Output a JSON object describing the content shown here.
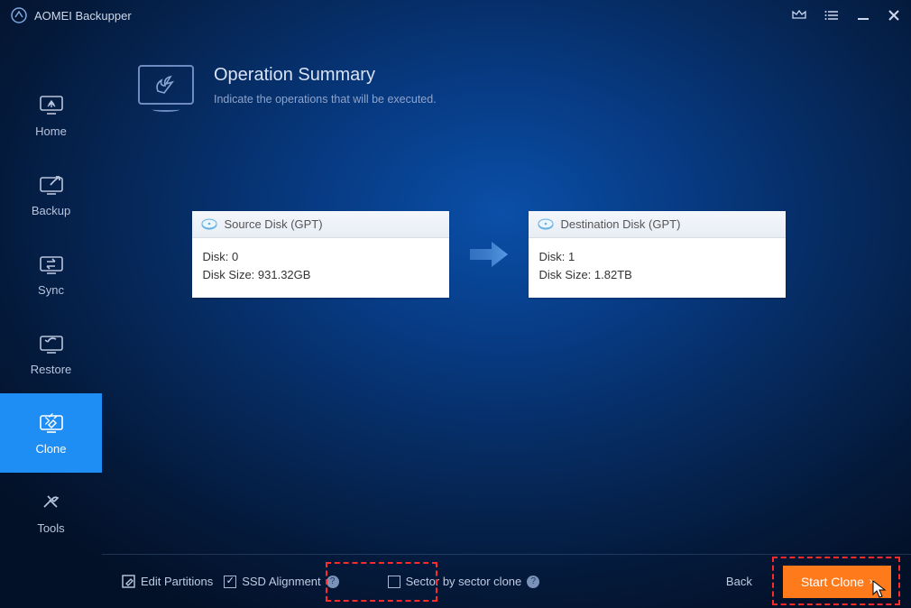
{
  "app": {
    "title": "AOMEI Backupper"
  },
  "sidebar": {
    "items": [
      {
        "label": "Home"
      },
      {
        "label": "Backup"
      },
      {
        "label": "Sync"
      },
      {
        "label": "Restore"
      },
      {
        "label": "Clone"
      },
      {
        "label": "Tools"
      }
    ],
    "active_index": 4
  },
  "header": {
    "title": "Operation Summary",
    "subtitle": "Indicate the operations that will be executed."
  },
  "source_disk": {
    "title": "Source Disk (GPT)",
    "line1": "Disk: 0",
    "line2": "Disk Size: 931.32GB"
  },
  "dest_disk": {
    "title": "Destination Disk (GPT)",
    "line1": "Disk: 1",
    "line2": "Disk Size: 1.82TB"
  },
  "bottombar": {
    "edit_partitions": "Edit Partitions",
    "ssd_alignment": "SSD Alignment",
    "sector_by_sector": "Sector by sector clone",
    "back": "Back",
    "start_clone": "Start Clone",
    "ssd_checked": true,
    "sector_checked": false
  }
}
